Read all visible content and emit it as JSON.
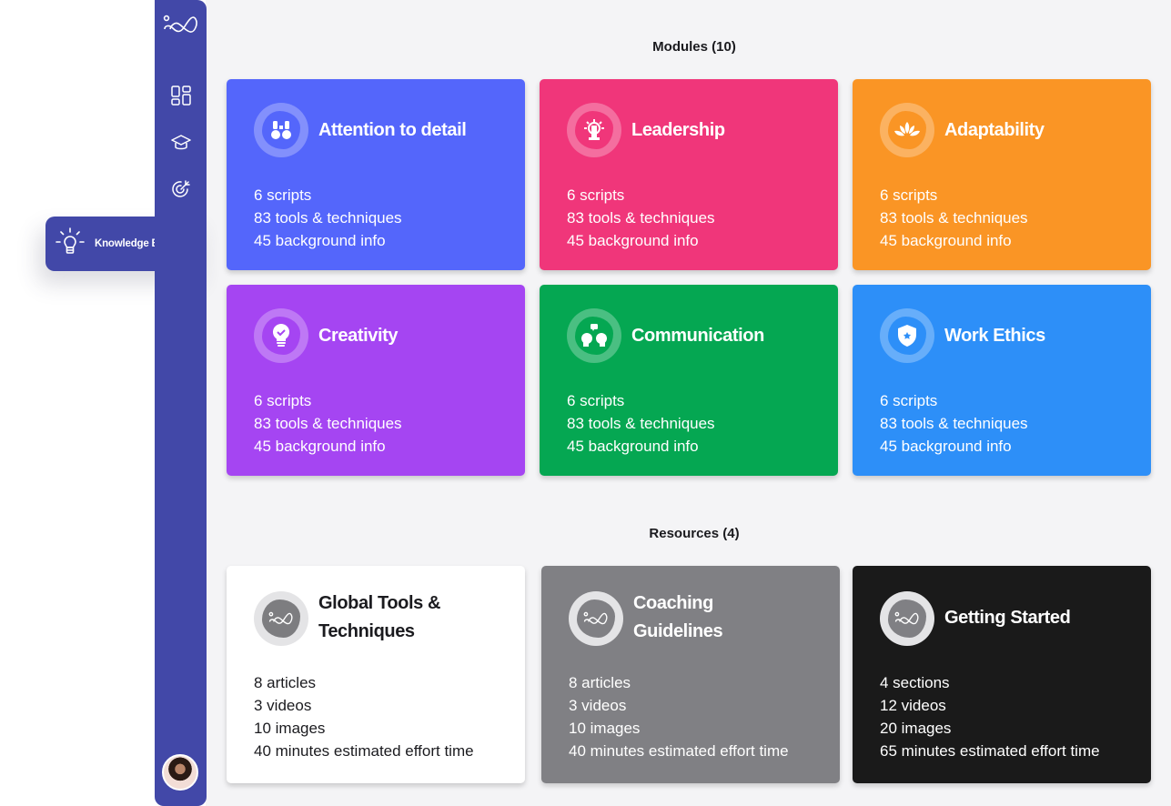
{
  "sidebar": {
    "logo_icon": "infinity-logo-icon",
    "items": [
      {
        "name": "dashboard",
        "icon": "grid-icon"
      },
      {
        "name": "learning",
        "icon": "graduation-cap-icon"
      },
      {
        "name": "goals",
        "icon": "target-icon"
      }
    ],
    "flyout": {
      "label": "Knowledge Base",
      "icon": "lightbulb-icon"
    },
    "avatar": "user-avatar"
  },
  "modules": {
    "title": "Modules (10)",
    "cards": [
      {
        "title": "Attention to detail",
        "icon": "binoculars-icon",
        "color": "#5466fb",
        "stats": [
          "6 scripts",
          "83 tools & techniques",
          "45 background info"
        ]
      },
      {
        "title": "Leadership",
        "icon": "lighthouse-icon",
        "color": "#f0367a",
        "stats": [
          "6 scripts",
          "83 tools & techniques",
          "45 background info"
        ]
      },
      {
        "title": "Adaptability",
        "icon": "lotus-icon",
        "color": "#fa9525",
        "stats": [
          "6 scripts",
          "83 tools & techniques",
          "45 background info"
        ]
      },
      {
        "title": "Creativity",
        "icon": "lightbulb-check-icon",
        "color": "#a545f2",
        "stats": [
          "6 scripts",
          "83 tools & techniques",
          "45 background info"
        ]
      },
      {
        "title": "Communication",
        "icon": "people-talking-icon",
        "color": "#05a752",
        "stats": [
          "6 scripts",
          "83 tools & techniques",
          "45 background info"
        ]
      },
      {
        "title": "Work Ethics",
        "icon": "shield-star-icon",
        "color": "#2d8ff8",
        "stats": [
          "6 scripts",
          "83 tools & techniques",
          "45 background info"
        ]
      }
    ]
  },
  "resources": {
    "title": "Resources (4)",
    "cards": [
      {
        "title_lines": [
          "Global Tools &",
          "Techniques"
        ],
        "icon": "infinity-logo-icon",
        "color": "#ffffff",
        "stats": [
          "8 articles",
          "3 videos",
          "10 images",
          "40 minutes estimated effort time"
        ]
      },
      {
        "title_lines": [
          "Coaching",
          "Guidelines"
        ],
        "icon": "infinity-logo-icon",
        "color": "#808084",
        "stats": [
          "8 articles",
          "3 videos",
          "10 images",
          "40 minutes estimated effort time"
        ]
      },
      {
        "title_lines": [
          "Getting Started"
        ],
        "icon": "infinity-logo-icon",
        "color": "#1a1a1a",
        "stats": [
          "4 sections",
          "12 videos",
          "20 images",
          "65 minutes estimated effort time"
        ]
      }
    ]
  }
}
